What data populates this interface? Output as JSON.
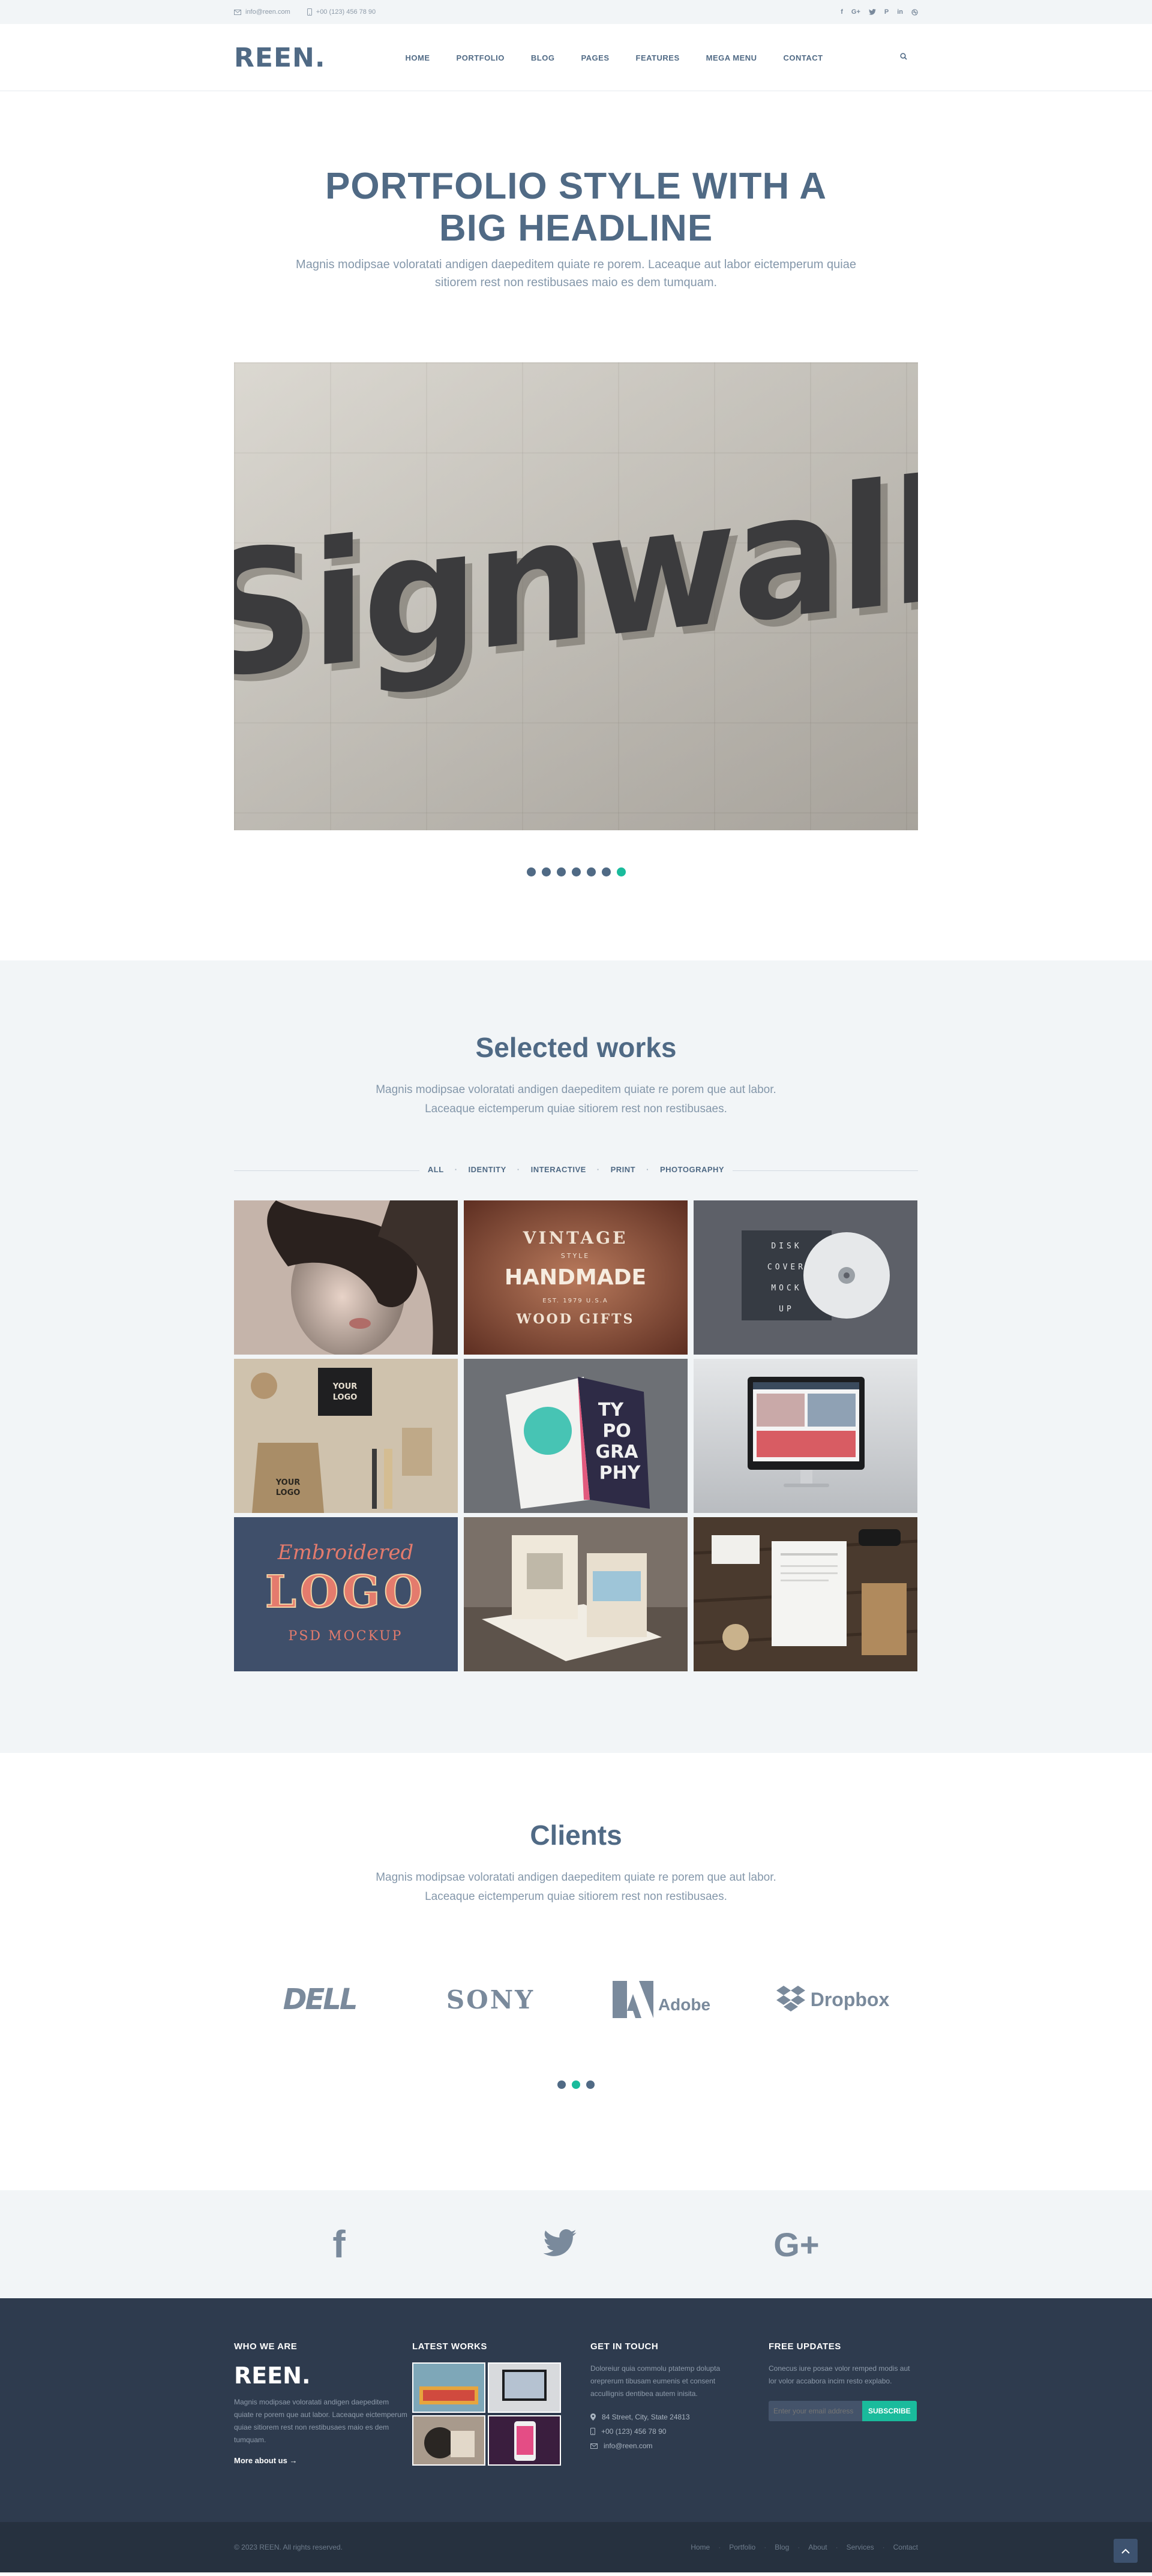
{
  "topbar": {
    "email": "info@reen.com",
    "phone": "+00 (123) 456 78 90",
    "social_icons": [
      "facebook-icon",
      "google-plus-icon",
      "twitter-icon",
      "pinterest-icon",
      "linkedin-icon",
      "dribbble-icon"
    ]
  },
  "header": {
    "logo": "REEN.",
    "nav": [
      "HOME",
      "PORTFOLIO",
      "BLOG",
      "PAGES",
      "FEATURES",
      "MEGA MENU",
      "CONTACT"
    ]
  },
  "hero": {
    "title_line1": "PORTFOLIO STYLE WITH A",
    "title_line2": "BIG HEADLINE",
    "subtitle": "Magnis modipsae voloratati andigen daepeditem quiate re porem. Laceaque aut labor eictemperum quiae sitiorem rest non restibusaes maio es dem tumquam.",
    "slide_text": "Signwall",
    "slide_count": 7,
    "active_slide": 6
  },
  "works": {
    "title": "Selected works",
    "subtitle_line1": "Magnis modipsae voloratati andigen daepeditem quiate re porem que aut labor.",
    "subtitle_line2": "Laceaque eictemperum quiae sitiorem rest non restibusaes.",
    "filters": [
      "ALL",
      "IDENTITY",
      "INTERACTIVE",
      "PRINT",
      "PHOTOGRAPHY"
    ],
    "tiles": {
      "t2": {
        "l1": "VINTAGE",
        "l2": "STYLE",
        "l3": "HANDMADE",
        "l4": "EST. 1979 U.S.A",
        "l5": "WOOD GIFTS"
      },
      "t3": {
        "l1": "DISK",
        "l2": "COVER",
        "l3": "MOCK",
        "l4": "UP"
      },
      "t4": {
        "l1": "YOUR",
        "l2": "LOGO"
      },
      "t5": {
        "l1": "TY",
        "l2": "PO",
        "l3": "GRA",
        "l4": "PHY"
      },
      "t7": {
        "l1": "Embroidered",
        "l2": "LOGO",
        "l3": "PSD MOCKUP"
      }
    }
  },
  "clients": {
    "title": "Clients",
    "subtitle_line1": "Magnis modipsae voloratati andigen daepeditem quiate re porem que aut labor.",
    "subtitle_line2": "Laceaque eictemperum quiae sitiorem rest non restibusaes.",
    "logos": [
      "DELL",
      "SONY",
      "Adobe",
      "Dropbox"
    ],
    "page_count": 3,
    "active_page": 1
  },
  "social_bar": [
    "facebook-icon",
    "twitter-icon",
    "google-plus-icon"
  ],
  "footer": {
    "who": {
      "heading": "WHO WE ARE",
      "logo": "REEN.",
      "text": "Magnis modipsae voloratati andigen daepeditem quiate re porem que aut labor. Laceaque eictemperum quiae sitiorem rest non restibusaes maio es dem tumquam.",
      "more": "More about us →"
    },
    "works": {
      "heading": "LATEST WORKS"
    },
    "touch": {
      "heading": "GET IN TOUCH",
      "text": "Doloreiur quia commolu ptatemp dolupta oreprerum tibusam eumenis et consent accullignis dentibea autem inisita.",
      "address": "84 Street, City, State 24813",
      "phone": "+00 (123) 456 78 90",
      "email": "info@reen.com"
    },
    "updates": {
      "heading": "FREE UPDATES",
      "text": "Conecus iure posae volor remped modis aut lor volor accabora incim resto explabo.",
      "placeholder": "Enter your email address",
      "button": "SUBSCRIBE"
    }
  },
  "bottombar": {
    "copyright": "© 2023 REEN. All rights reserved.",
    "links": [
      "Home",
      "Portfolio",
      "Blog",
      "About",
      "Services",
      "Contact"
    ]
  },
  "colors": {
    "brand": "#506a85",
    "accent": "#1abb9c",
    "footer": "#2e3b4e"
  }
}
